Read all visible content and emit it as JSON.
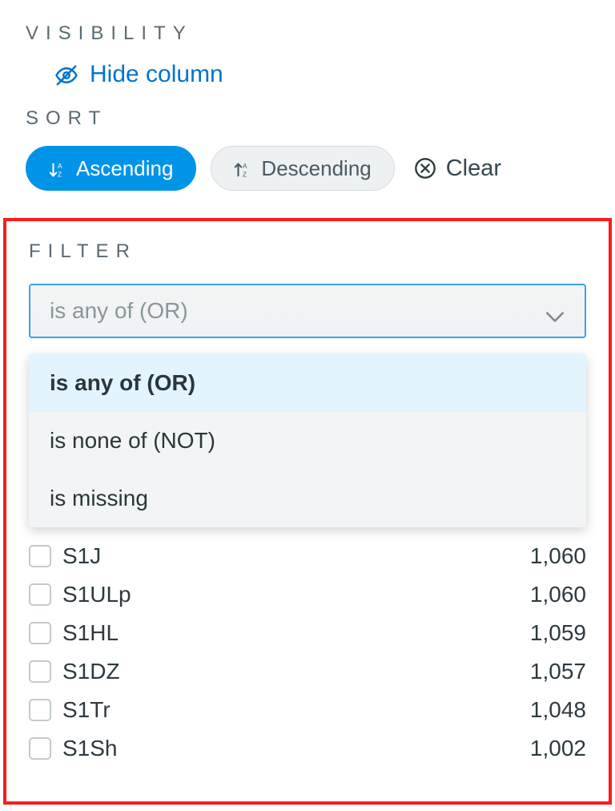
{
  "visibility": {
    "section_label": "VISIBILITY",
    "hide_label": "Hide column"
  },
  "sort": {
    "section_label": "SORT",
    "ascending_label": "Ascending",
    "descending_label": "Descending",
    "clear_label": "Clear"
  },
  "filter": {
    "section_label": "FILTER",
    "select_placeholder": "is any of (OR)",
    "options": [
      {
        "label": "is any of (OR)",
        "selected": true
      },
      {
        "label": "is none of (NOT)",
        "selected": false
      },
      {
        "label": "is missing",
        "selected": false
      }
    ],
    "rows": [
      {
        "name": "S1J",
        "count": "1,060"
      },
      {
        "name": "S1ULp",
        "count": "1,060"
      },
      {
        "name": "S1HL",
        "count": "1,059"
      },
      {
        "name": "S1DZ",
        "count": "1,057"
      },
      {
        "name": "S1Tr",
        "count": "1,048"
      },
      {
        "name": "S1Sh",
        "count": "1,002"
      }
    ]
  },
  "colors": {
    "accent_blue": "#0094e8",
    "link_blue": "#0073cf",
    "highlight_red": "#ff1a1a"
  }
}
